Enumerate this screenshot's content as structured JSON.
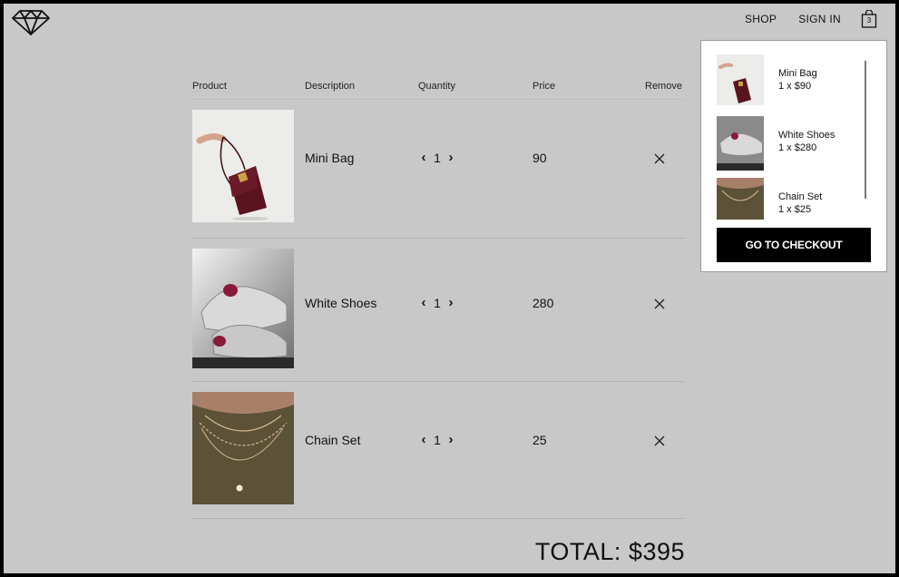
{
  "header": {
    "logo_icon": "diamond-icon",
    "nav": {
      "shop": "SHOP",
      "signin": "SIGN IN"
    },
    "cart": {
      "icon": "shopping-bag-icon",
      "count": "3"
    }
  },
  "table": {
    "headers": {
      "product": "Product",
      "description": "Description",
      "quantity": "Quantity",
      "price": "Price",
      "remove": "Remove"
    },
    "rows": [
      {
        "name": "Mini Bag",
        "quantity": "1",
        "price": "90"
      },
      {
        "name": "White Shoes",
        "quantity": "1",
        "price": "280"
      },
      {
        "name": "Chain Set",
        "quantity": "1",
        "price": "25"
      }
    ],
    "qty_decrease_glyph": "‹",
    "qty_increase_glyph": "›"
  },
  "total": "TOTAL: $395",
  "mini_cart": {
    "items": [
      {
        "name": "Mini Bag",
        "qty_price": "1 x $90"
      },
      {
        "name": "White Shoes",
        "qty_price": "1 x $280"
      },
      {
        "name": "Chain Set",
        "qty_price": "1 x $25"
      }
    ],
    "checkout_label": "GO TO CHECKOUT"
  },
  "colors": {
    "page_bg": "#c8c8c8",
    "frame": "#000000",
    "checkout_bg": "#000000",
    "bag": "#5a1420",
    "shoe_accent": "#8a1a3a",
    "chain_bg": "#5b5238"
  }
}
